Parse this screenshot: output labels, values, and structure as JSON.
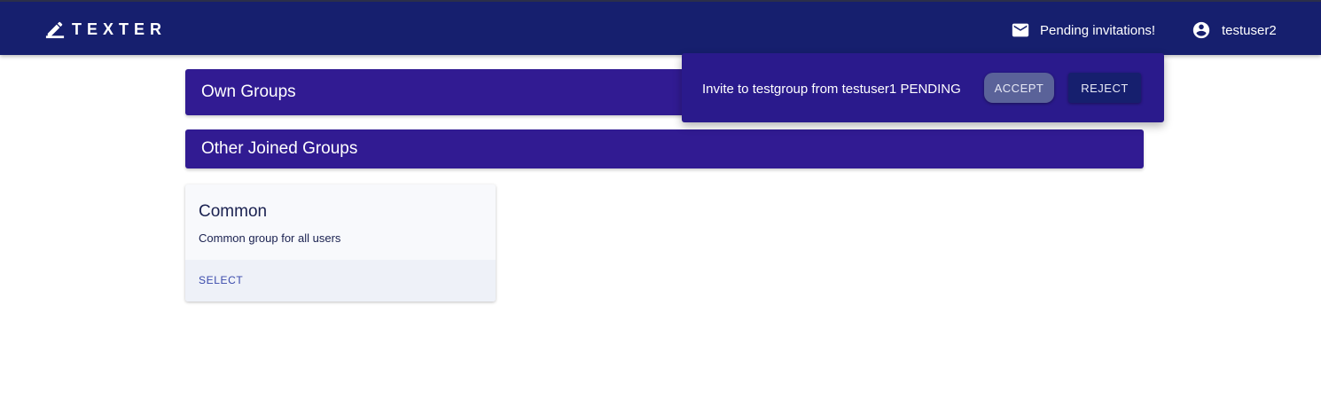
{
  "header": {
    "brand": "TEXTER",
    "brand_icon": "pencil-icon",
    "invites_label": "Pending invitations!",
    "invites_icon": "mail-icon",
    "user_label": "testuser2",
    "user_icon": "account-circle-icon"
  },
  "groups": {
    "own_title": "Own Groups",
    "other_title": "Other Joined Groups"
  },
  "cards": [
    {
      "title": "Common",
      "description": "Common group for all users",
      "action": "SELECT"
    }
  ],
  "invitation_popover": {
    "text": "Invite to testgroup from testuser1 PENDING",
    "accept_label": "ACCEPT",
    "reject_label": "REJECT"
  },
  "colors": {
    "app_bar": "#161f6e",
    "section_bar": "#311b92",
    "popover": "#2a1a8c",
    "link": "#3949ab"
  }
}
